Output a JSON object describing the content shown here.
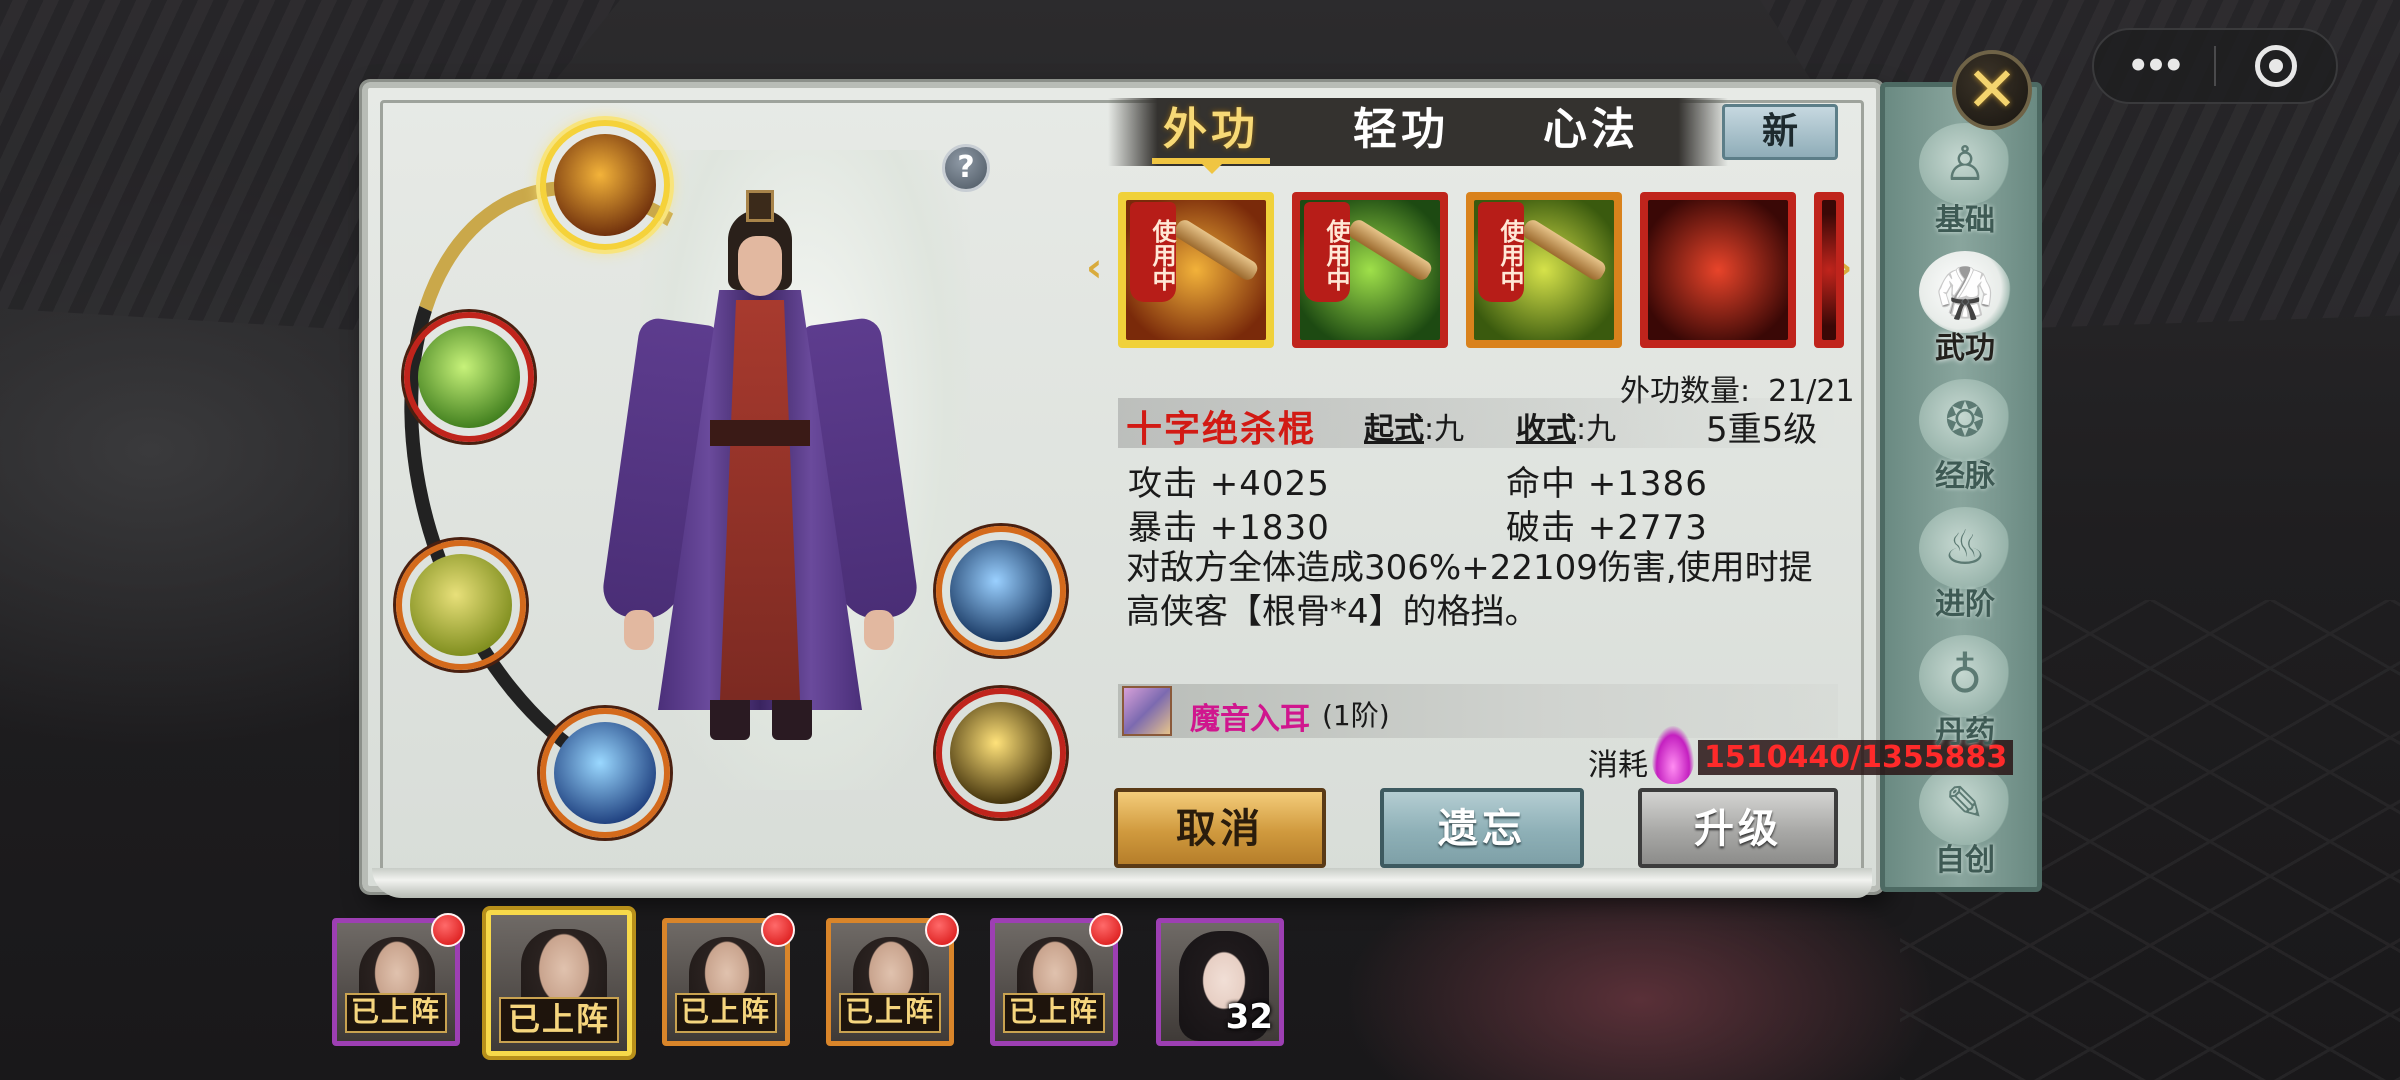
{
  "capsule": {
    "more_icon": "more-dots-icon",
    "target_icon": "target-icon"
  },
  "close": {
    "label": "✕",
    "icon": "close-icon"
  },
  "tabs": [
    {
      "label": "外功",
      "active": true
    },
    {
      "label": "轻功",
      "active": false
    },
    {
      "label": "心法",
      "active": false
    }
  ],
  "new_button": "新",
  "help": "?",
  "side_nav": [
    {
      "label": "基础",
      "icon": "figure-icon",
      "active": false
    },
    {
      "label": "武功",
      "icon": "martial-pose-icon",
      "active": true
    },
    {
      "label": "经脉",
      "icon": "meridian-icon",
      "active": false
    },
    {
      "label": "进阶",
      "icon": "flame-icon",
      "active": false
    },
    {
      "label": "丹药",
      "icon": "gourd-icon",
      "active": false
    },
    {
      "label": "自创",
      "icon": "scroll-icon",
      "active": false
    }
  ],
  "skills_row": [
    {
      "tag": "使用中",
      "icon": "staff-cross-icon",
      "colors": [
        "#7a2a0a",
        "#f2b23a"
      ],
      "border": "#f0d13a"
    },
    {
      "tag": "使用中",
      "icon": "staff-green-icon",
      "colors": [
        "#1d4a12",
        "#9fe04a"
      ],
      "border": "#c0241c"
    },
    {
      "tag": "使用中",
      "icon": "staff-orange-icon",
      "colors": [
        "#3a5a0e",
        "#d6e24a"
      ],
      "border": "#d9821c"
    },
    {
      "tag": "",
      "icon": "spinning-staff-icon",
      "colors": [
        "#3a0806",
        "#e8442a"
      ],
      "border": "#c0241c"
    },
    {
      "tag": "",
      "icon": "partial-skill-icon",
      "colors": [
        "#3a0806",
        "#c0241c"
      ],
      "border": "#c0241c"
    }
  ],
  "count": {
    "label": "外功数量:",
    "value": "21/21"
  },
  "skill": {
    "name": "十字绝杀棍",
    "start_key": "起式",
    "start_val": ":九",
    "end_key": "收式",
    "end_val": ":九",
    "level": "5重5级",
    "stats": {
      "attack": "攻击 +4025",
      "hit": "命中 +1386",
      "crit": "暴击 +1830",
      "pierce": "破击 +2773"
    },
    "description": "对敌方全体造成306%+22109伤害,使用时提高侠客【根骨*4】的格挡。"
  },
  "linked": {
    "name": "魔音入耳",
    "rank": "(1阶)"
  },
  "cost": {
    "label": "消耗",
    "value": "1510440/1355883"
  },
  "buttons": {
    "cancel": "取消",
    "forget": "遗忘",
    "upgrade": "升级"
  },
  "orbs": [
    {
      "name": "cross-staff-skill-icon",
      "selected": true,
      "colors": [
        "#f3b33a",
        "#6a2a0a"
      ]
    },
    {
      "name": "green-staff-skill-icon",
      "selected": false,
      "colors": [
        "#c7f27a",
        "#3b7a1a"
      ]
    },
    {
      "name": "orange-staff-skill-icon",
      "selected": false,
      "colors": [
        "#e8e07a",
        "#7a8a1a"
      ]
    },
    {
      "name": "blue-blade-skill-icon",
      "selected": false,
      "colors": [
        "#9ad8ff",
        "#1a3a7a"
      ]
    },
    {
      "name": "lightqi-skill-icon",
      "selected": false,
      "colors": [
        "#9ad0ff",
        "#12305a"
      ]
    },
    {
      "name": "meditation-skill-icon",
      "selected": false,
      "colors": [
        "#ffe27a",
        "#3a2a06"
      ]
    }
  ],
  "roster": [
    {
      "tag": "已上阵",
      "dot": true,
      "selected": false,
      "rarity": "purple"
    },
    {
      "tag": "已上阵",
      "dot": false,
      "selected": true,
      "rarity": "gold"
    },
    {
      "tag": "已上阵",
      "dot": true,
      "selected": false,
      "rarity": "orange"
    },
    {
      "tag": "已上阵",
      "dot": true,
      "selected": false,
      "rarity": "orange"
    },
    {
      "tag": "已上阵",
      "dot": true,
      "selected": false,
      "rarity": "purple"
    },
    {
      "tag": "",
      "dot": false,
      "selected": false,
      "rarity": "purple",
      "level": "32"
    }
  ]
}
